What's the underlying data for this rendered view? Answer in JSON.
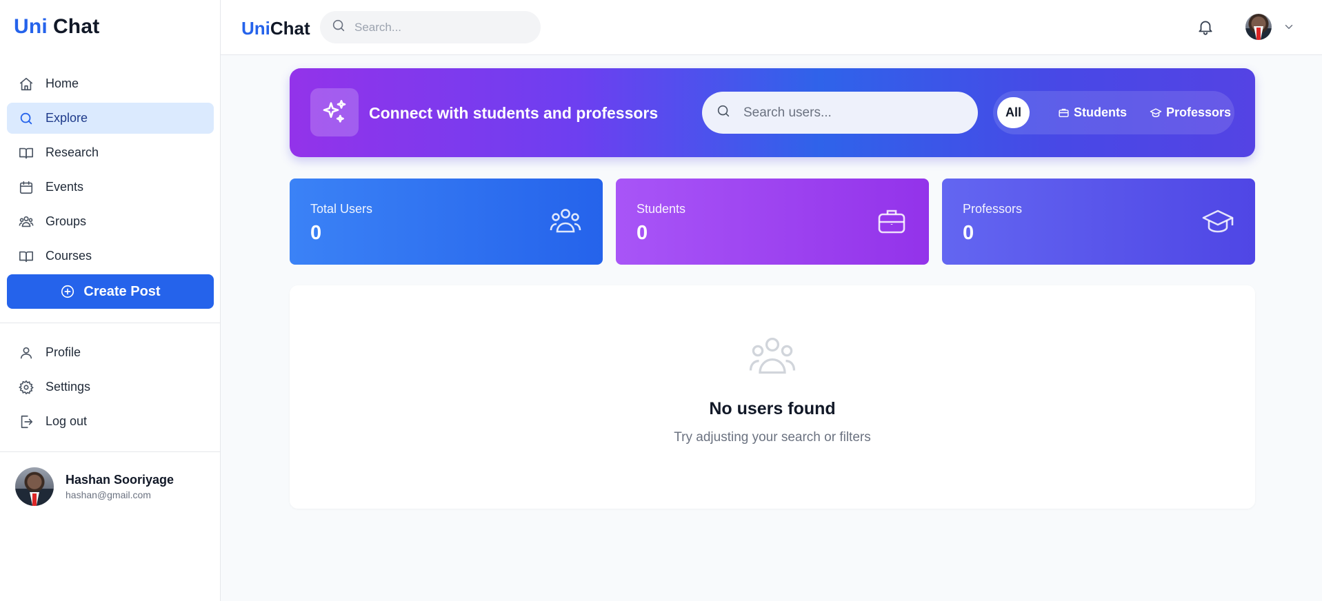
{
  "app": {
    "logo_uni": "Uni",
    "logo_chat": "Chat"
  },
  "sidebar": {
    "items": [
      {
        "label": "Home",
        "icon": "home-icon"
      },
      {
        "label": "Explore",
        "icon": "search-icon",
        "active": true
      },
      {
        "label": "Research",
        "icon": "book-open-icon"
      },
      {
        "label": "Events",
        "icon": "calendar-icon"
      },
      {
        "label": "Groups",
        "icon": "users-icon"
      },
      {
        "label": "Courses",
        "icon": "book-open-icon"
      }
    ],
    "create_post_label": "Create Post",
    "secondary_items": [
      {
        "label": "Profile",
        "icon": "user-icon"
      },
      {
        "label": "Settings",
        "icon": "gear-icon"
      },
      {
        "label": "Log out",
        "icon": "logout-icon"
      }
    ],
    "user": {
      "name": "Hashan Sooriyage",
      "email": "hashan@gmail.com"
    }
  },
  "header": {
    "search_placeholder": "Search..."
  },
  "banner": {
    "title": "Connect with students and professors",
    "search_placeholder": "Search users...",
    "filters": [
      {
        "label": "All",
        "active": true
      },
      {
        "label": "Students",
        "icon": "briefcase-icon"
      },
      {
        "label": "Professors",
        "icon": "graduation-cap-icon"
      }
    ]
  },
  "stats": [
    {
      "label": "Total Users",
      "value": "0",
      "icon": "users-icon"
    },
    {
      "label": "Students",
      "value": "0",
      "icon": "briefcase-icon"
    },
    {
      "label": "Professors",
      "value": "0",
      "icon": "graduation-cap-icon"
    }
  ],
  "empty_state": {
    "title": "No users found",
    "subtitle": "Try adjusting your search or filters"
  },
  "colors": {
    "accent": "#2563eb",
    "active_nav_bg": "#dbeafe"
  }
}
